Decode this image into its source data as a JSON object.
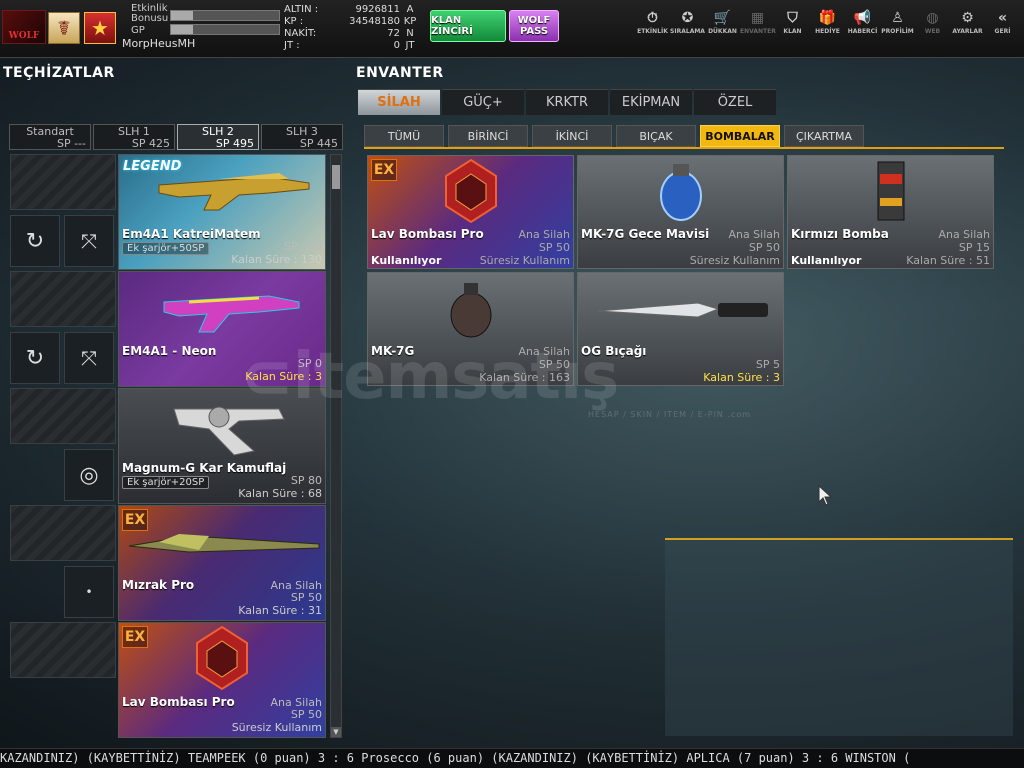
{
  "header": {
    "username": "MorpHeusMH",
    "event_bonus_label": "Etkinlik Bonusu",
    "gp_label": "GP",
    "event_progress": 0.2,
    "gp_progress": 0.2,
    "stats": [
      {
        "label": "ALTIN :",
        "value": "9926811",
        "unit": "A"
      },
      {
        "label": "KP :",
        "value": "34548180",
        "unit": "KP"
      },
      {
        "label": "NAKİT:",
        "value": "72",
        "unit": "N"
      },
      {
        "label": "JT :",
        "value": "0",
        "unit": "JT"
      }
    ],
    "klan_button": "KLAN ZİNCİRİ",
    "wolf_button": "WOLF PASS",
    "menu": [
      {
        "label": "ETKİNLİK",
        "icon": "stopwatch-icon",
        "glyph": "⏱",
        "dim": false
      },
      {
        "label": "SIRALAMA",
        "icon": "medal-icon",
        "glyph": "✪",
        "dim": false
      },
      {
        "label": "DÜKKAN",
        "icon": "cart-icon",
        "glyph": "🛒",
        "dim": false
      },
      {
        "label": "ENVANTER",
        "icon": "inventory-icon",
        "glyph": "▦",
        "dim": true
      },
      {
        "label": "KLAN",
        "icon": "shield-icon",
        "glyph": "⛉",
        "dim": false
      },
      {
        "label": "HEDİYE",
        "icon": "gift-icon",
        "glyph": "🎁",
        "dim": false
      },
      {
        "label": "HABERCİ",
        "icon": "megaphone-icon",
        "glyph": "📢",
        "dim": false
      },
      {
        "label": "PROFİLİM",
        "icon": "profile-icon",
        "glyph": "♙",
        "dim": false
      },
      {
        "label": "WEB",
        "icon": "globe-icon",
        "glyph": "◍",
        "dim": true
      },
      {
        "label": "AYARLAR",
        "icon": "gear-icon",
        "glyph": "⚙",
        "dim": false
      },
      {
        "label": "GERİ",
        "icon": "back-icon",
        "glyph": "«",
        "dim": false
      }
    ]
  },
  "left": {
    "title": "TEÇHİZATLAR",
    "slot_tabs": [
      {
        "name": "Standart",
        "sp": "SP ---",
        "active": false
      },
      {
        "name": "SLH 1",
        "sp": "SP 425",
        "active": false
      },
      {
        "name": "SLH 2",
        "sp": "SP 495",
        "active": true
      },
      {
        "name": "SLH 3",
        "sp": "SP 445",
        "active": false
      }
    ],
    "cards": [
      {
        "name": "Em4A1 KatreiMatem",
        "ek": "Ek şarjör+50SP",
        "cat": "",
        "sp": "SP 300",
        "sure": "Kalan Süre : 130",
        "yellow": false,
        "badge": "LEGEND"
      },
      {
        "name": "EM4A1 - Neon",
        "ek": "",
        "cat": "",
        "sp": "SP 0",
        "sure": "Kalan Süre : 3",
        "yellow": true,
        "badge": ""
      },
      {
        "name": "Magnum-G Kar Kamuflaj",
        "ek": "Ek şarjör+20SP",
        "cat": "",
        "sp": "SP 80",
        "sure": "Kalan Süre : 68",
        "yellow": false,
        "badge": ""
      },
      {
        "name": "Mızrak Pro",
        "ek": "",
        "cat": "Ana Silah",
        "sp": "SP 50",
        "sure": "Kalan Süre : 31",
        "yellow": false,
        "badge": "EX"
      },
      {
        "name": "Lav Bombası Pro",
        "ek": "",
        "cat": "Ana Silah",
        "sp": "SP 50",
        "sure": "Süresiz Kullanım",
        "yellow": false,
        "badge": "EX"
      }
    ]
  },
  "right": {
    "title": "ENVANTER",
    "main_tabs": [
      {
        "label": "SİLAH",
        "active": true
      },
      {
        "label": "GÜÇ+",
        "active": false
      },
      {
        "label": "KRKTR",
        "active": false
      },
      {
        "label": "EKİPMAN",
        "active": false
      },
      {
        "label": "ÖZEL",
        "active": false
      }
    ],
    "sub_tabs": [
      {
        "label": "TÜMÜ",
        "active": false
      },
      {
        "label": "BİRİNCİ",
        "active": false
      },
      {
        "label": "İKİNCİ",
        "active": false
      },
      {
        "label": "BIÇAK",
        "active": false
      },
      {
        "label": "BOMBALAR",
        "active": true
      },
      {
        "label": "ÇIKARTMA",
        "active": false
      }
    ],
    "items": [
      {
        "name": "Lav Bombası Pro",
        "cat": "Ana Silah",
        "sp": "SP 50",
        "use": "Kullanılıyor",
        "sure": "Süresiz Kullanım",
        "yellow": false,
        "badge": "EX"
      },
      {
        "name": "MK-7G Gece Mavisi",
        "cat": "Ana Silah",
        "sp": "SP 50",
        "use": "",
        "sure": "Süresiz Kullanım",
        "yellow": false,
        "badge": ""
      },
      {
        "name": "Kırmızı Bomba",
        "cat": "Ana Silah",
        "sp": "SP 15",
        "use": "Kullanılıyor",
        "sure": "Kalan Süre : 51",
        "yellow": false,
        "badge": ""
      },
      {
        "name": "MK-7G",
        "cat": "Ana Silah",
        "sp": "SP 50",
        "use": "",
        "sure": "Kalan Süre : 163",
        "yellow": false,
        "badge": ""
      },
      {
        "name": "OG Bıçağı",
        "cat": "",
        "sp": "SP 5",
        "use": "",
        "sure": "Kalan Süre : 3",
        "yellow": true,
        "badge": ""
      }
    ]
  },
  "ticker": "KAZANDINIZ)   (KAYBETTİNİZ) TEAMPEEK (0 puan) 3 : 6 Prosecco (6 puan) (KAZANDINIZ)      (KAYBETTİNİZ) APLICA (7 puan) 3 : 6 WINSTON (",
  "colors": {
    "accent": "#f2b810",
    "tab_active_text": "#e07010",
    "green_button": "#3fd070",
    "purple_button": "#d880f0"
  }
}
